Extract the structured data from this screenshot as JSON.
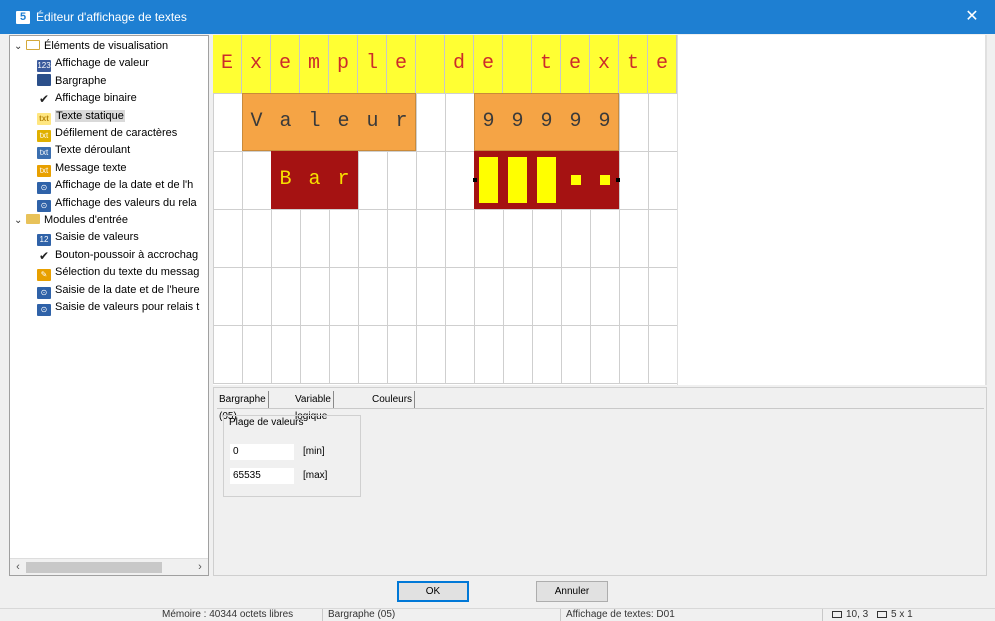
{
  "window": {
    "title": "Éditeur d'affichage de textes",
    "app_icon": "5",
    "close_glyph": "✕"
  },
  "tree": {
    "groups": [
      {
        "label": "Éléments de visualisation",
        "items": [
          {
            "label": "Affichage de valeur",
            "icon": "value-display-icon",
            "selected": false
          },
          {
            "label": "Bargraphe",
            "icon": "bargraph-icon",
            "selected": false
          },
          {
            "label": "Affichage binaire",
            "icon": "checkmark-icon",
            "selected": false
          },
          {
            "label": "Texte statique",
            "icon": "txt-icon",
            "selected": true
          },
          {
            "label": "Défilement de caractères",
            "icon": "txt-scroll-icon",
            "selected": false
          },
          {
            "label": "Texte déroulant",
            "icon": "txt-rolling-icon",
            "selected": false
          },
          {
            "label": "Message texte",
            "icon": "message-text-icon",
            "selected": false
          },
          {
            "label": "Affichage de la date et de l'h",
            "icon": "date-time-icon",
            "selected": false
          },
          {
            "label": "Affichage des valeurs du rela",
            "icon": "relay-values-icon",
            "selected": false
          }
        ]
      },
      {
        "label": "Modules d'entrée",
        "items": [
          {
            "label": "Saisie de valeurs",
            "icon": "value-input-icon",
            "selected": false
          },
          {
            "label": "Bouton-poussoir à accrochag",
            "icon": "checkmark-icon",
            "selected": false
          },
          {
            "label": "Sélection du texte du messag",
            "icon": "message-select-icon",
            "selected": false
          },
          {
            "label": "Saisie de la date et de l'heure",
            "icon": "date-time-input-icon",
            "selected": false
          },
          {
            "label": "Saisie de valeurs pour relais t",
            "icon": "relay-input-icon",
            "selected": false
          }
        ]
      }
    ]
  },
  "display": {
    "row1_chars": [
      "E",
      "x",
      "e",
      "m",
      "p",
      "l",
      "e",
      "",
      "d",
      "e",
      "",
      "t",
      "e",
      "x",
      "t",
      "e"
    ],
    "row2_chars": [
      "V",
      "a",
      "l",
      "e",
      "u",
      "r",
      "",
      "",
      "9",
      "9",
      "9",
      "9",
      "9"
    ],
    "row3_chars": [
      "B",
      "a",
      "r"
    ],
    "bar_levels": [
      1,
      1,
      1,
      0.2,
      0.2
    ],
    "colors": {
      "static_text_bg": "#ffff33",
      "static_text_fg": "#cc2b2b",
      "value_bg": "#f5a445",
      "bar_bg": "#a51212",
      "bar_fg": "#f7e000"
    }
  },
  "props": {
    "tabs": [
      "Bargraphe (05)",
      "Variable logique",
      "Couleurs"
    ],
    "group_title": "Plage de valeurs",
    "min_value": "0",
    "min_label": "[min]",
    "max_value": "65535",
    "max_label": "[max]"
  },
  "buttons": {
    "ok": "OK",
    "cancel": "Annuler"
  },
  "status": {
    "memory": "Mémoire : 40344 octets libres",
    "element": "Bargraphe (05)",
    "display": "Affichage de textes: D01",
    "size": "10, 3",
    "char_size": "5 x 1"
  }
}
